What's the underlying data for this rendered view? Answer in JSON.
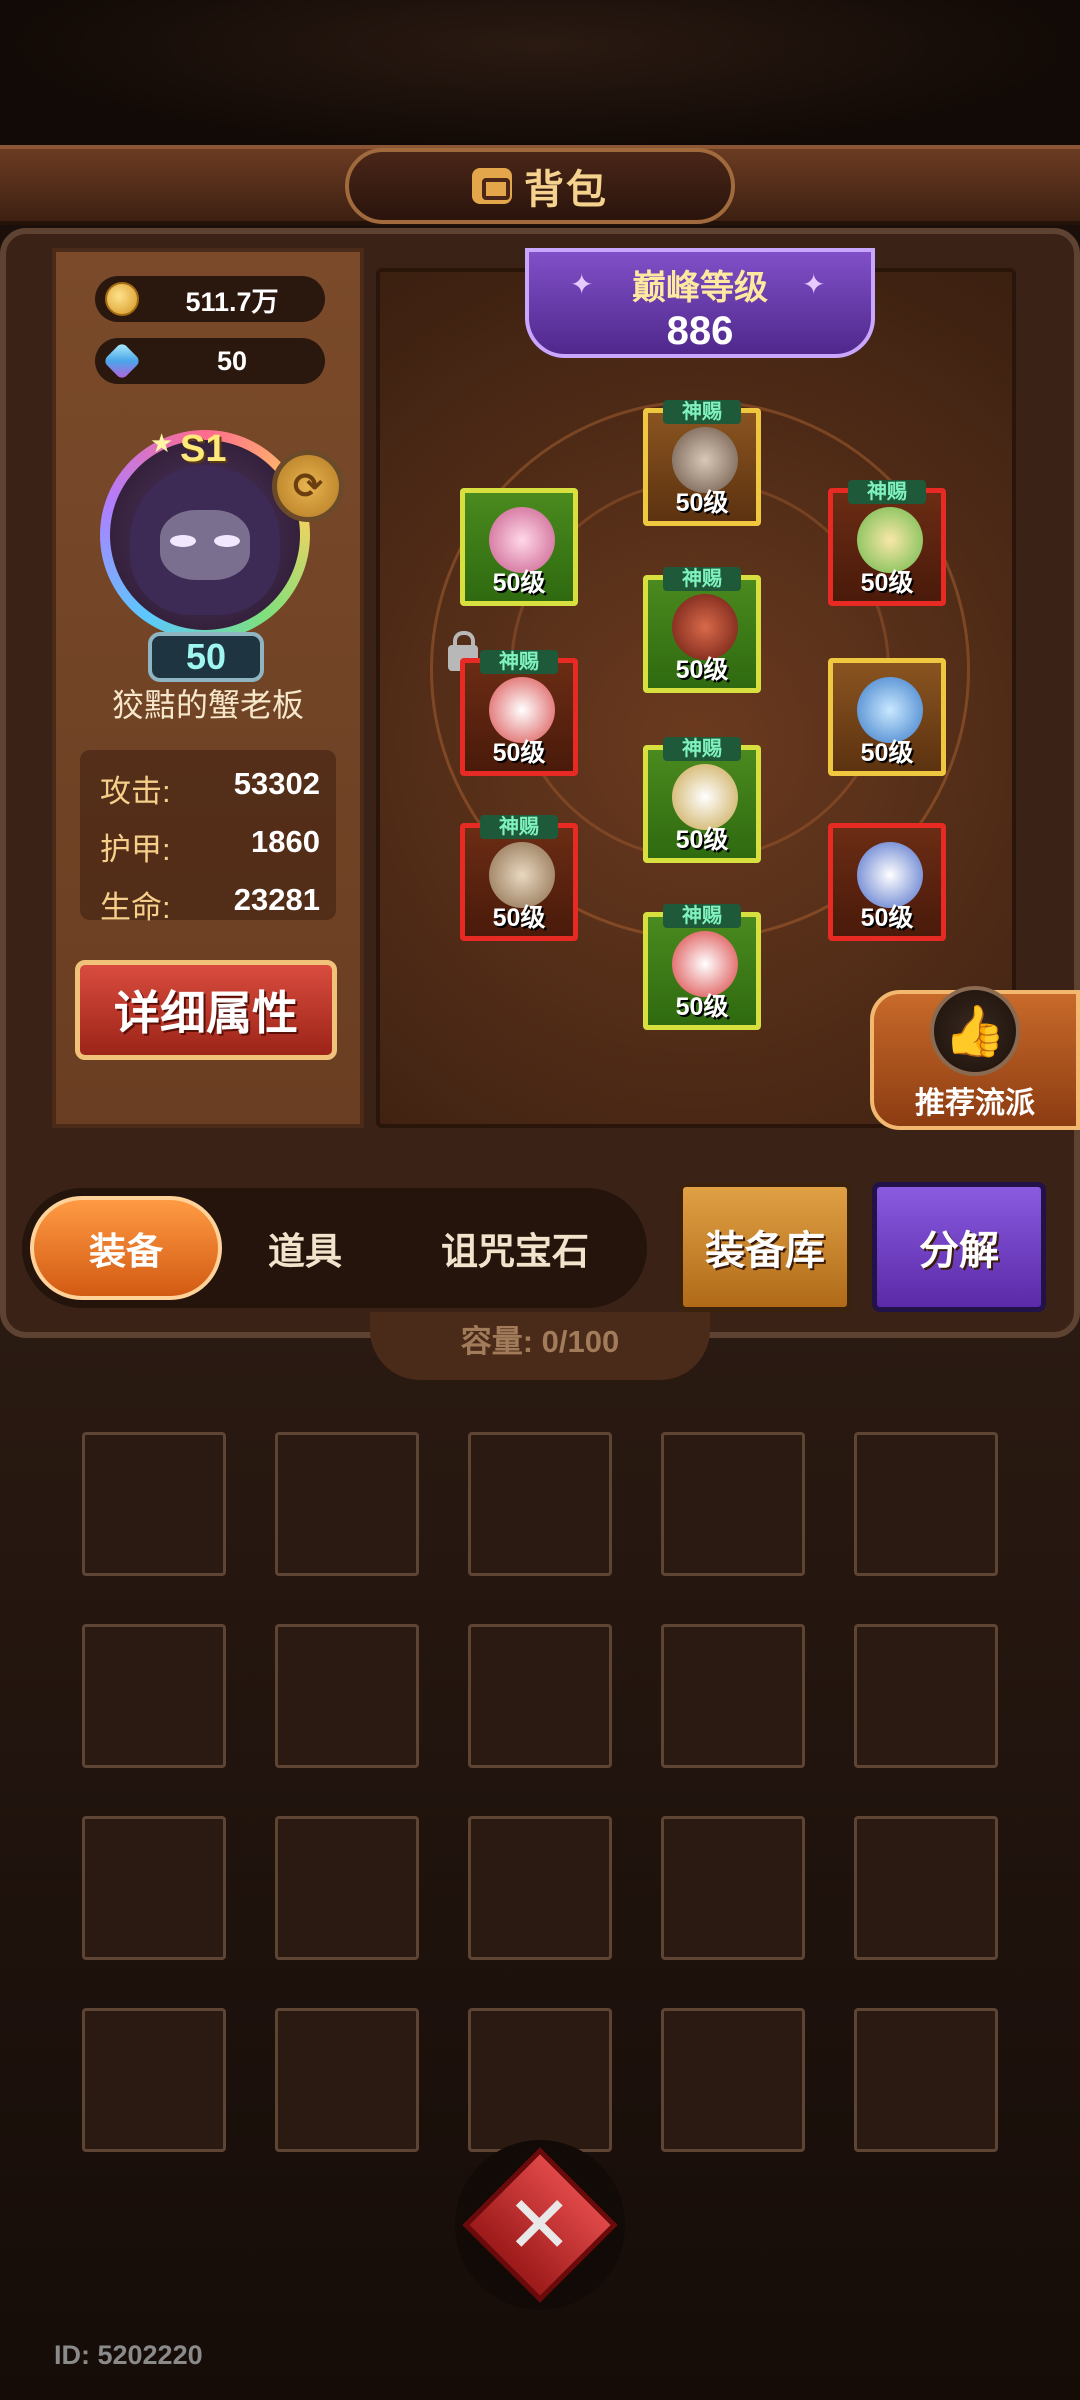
{
  "header": {
    "title": "背包"
  },
  "currency": [
    {
      "icon": "gold-coin-icon",
      "value": "511.7万"
    },
    {
      "icon": "gem-icon",
      "value": "50"
    }
  ],
  "hero": {
    "rank": "S1",
    "level": "50",
    "name": "狡黠的蟹老板",
    "stats": [
      {
        "label": "攻击:",
        "value": "53302"
      },
      {
        "label": "护甲:",
        "value": "1860"
      },
      {
        "label": "生命:",
        "value": "23281"
      }
    ],
    "detail_button": "详细属性"
  },
  "peak": {
    "title": "巅峰等级",
    "value": "886"
  },
  "equipment": {
    "tag_text": "神赐",
    "slots": [
      {
        "name": "helmet",
        "level": "50级",
        "rarity": "orange",
        "tag": true
      },
      {
        "name": "shoulder",
        "level": "50级",
        "rarity": "green",
        "tag": false
      },
      {
        "name": "necklace",
        "level": "50级",
        "rarity": "red",
        "tag": true
      },
      {
        "name": "chest",
        "level": "50级",
        "rarity": "green",
        "tag": true
      },
      {
        "name": "glove",
        "level": "50级",
        "rarity": "red",
        "tag": true
      },
      {
        "name": "ring",
        "level": "50级",
        "rarity": "orange",
        "tag": false
      },
      {
        "name": "pants",
        "level": "50级",
        "rarity": "green",
        "tag": true
      },
      {
        "name": "weapon",
        "level": "50级",
        "rarity": "red",
        "tag": true
      },
      {
        "name": "potion",
        "level": "50级",
        "rarity": "red",
        "tag": false
      },
      {
        "name": "boots",
        "level": "50级",
        "rarity": "green",
        "tag": true
      }
    ]
  },
  "recommend": {
    "label": "推荐流派"
  },
  "tabs": {
    "equip": "装备",
    "items": "道具",
    "curse_gems": "诅咒宝石"
  },
  "buttons": {
    "storage": "装备库",
    "decompose": "分解"
  },
  "capacity": {
    "text": "容量: 0/100"
  },
  "footer": {
    "user_id": "ID: 5202220"
  },
  "colors": {
    "accent_orange": "#d25a12",
    "tag_green": "#7ff2c0",
    "purple": "#5a2aa8"
  }
}
